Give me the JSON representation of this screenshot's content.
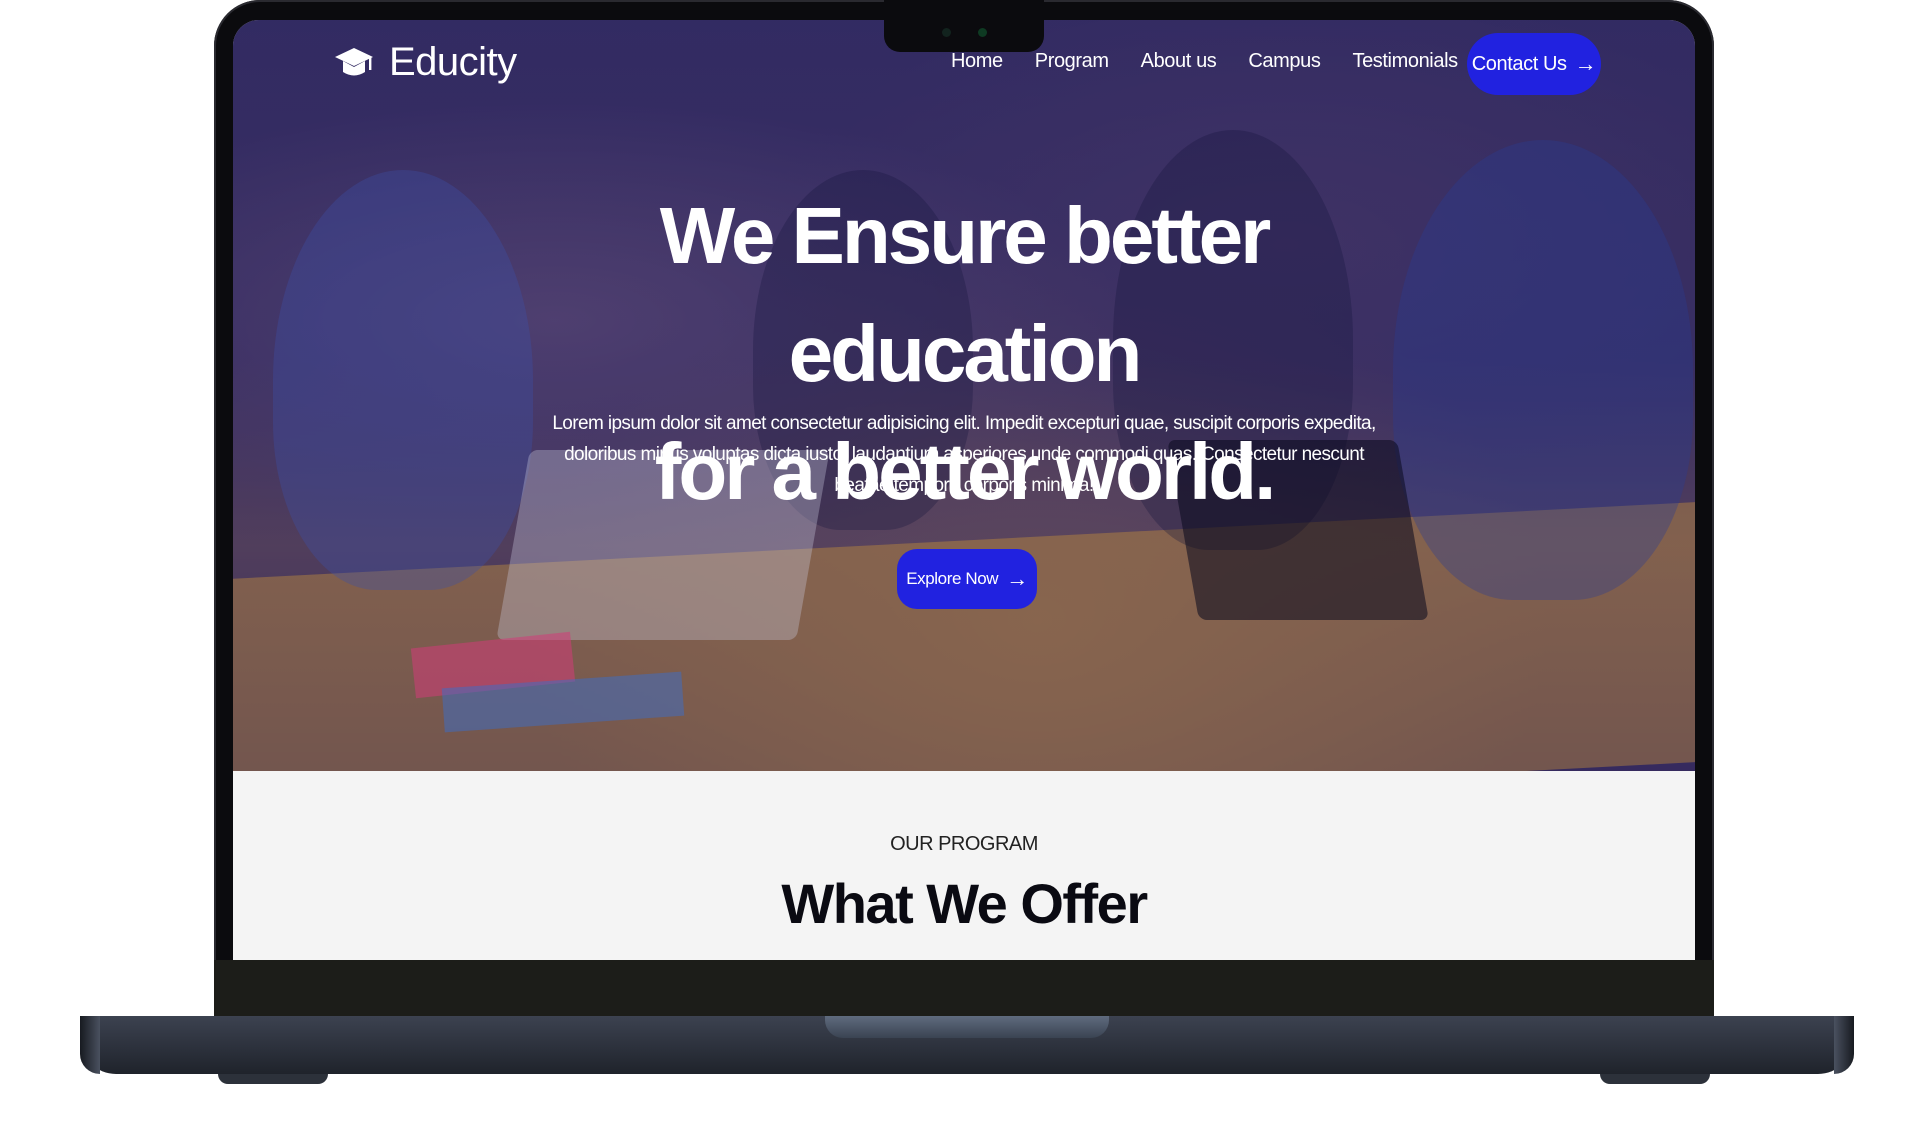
{
  "nav": {
    "brand": "Educity",
    "links": [
      "Home",
      "Program",
      "About us",
      "Campus",
      "Testimonials"
    ],
    "contact_label": "Contact Us"
  },
  "hero": {
    "title_line1": "We Ensure better education",
    "title_line2": "for a better world.",
    "text": "Lorem ipsum dolor sit amet consectetur adipisicing elit. Impedit excepturi quae, suscipit corporis expedita, doloribus minus voluptas dicta iusto, laudantium asperiores unde commodi quas. Consectetur nescunt beatae tempore corporis minima!",
    "button_label": "Explore Now"
  },
  "program": {
    "subtitle": "OUR PROGRAM",
    "title": "What We Offer"
  },
  "colors": {
    "accent": "#2122e0",
    "hero_overlay": "#241b6e",
    "section_bg": "#f4f4f4"
  },
  "icons": {
    "logo": "graduation-cap-icon",
    "button_arrow": "arrow-right-icon"
  }
}
